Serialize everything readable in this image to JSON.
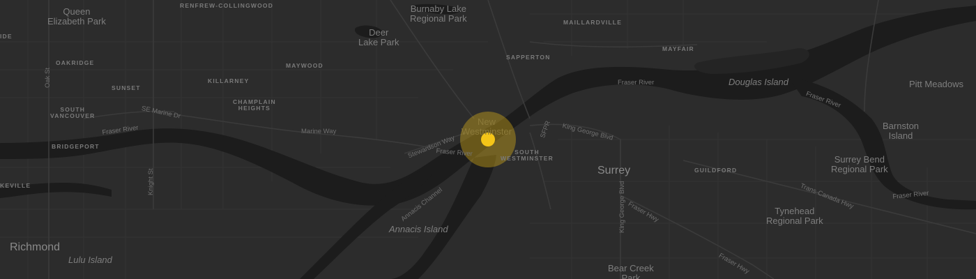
{
  "map": {
    "theme": "dark",
    "colors": {
      "land": "#2c2c2c",
      "water": "#1c1c1c",
      "roads": "#383838",
      "marker": "#f5c518",
      "marker_halo": "rgba(245,197,24,0.35)"
    },
    "marker": {
      "name": "New Westminster"
    },
    "places": {
      "queen_elizabeth_park": "Queen\nElizabeth Park",
      "renfrew": "RENFREW-COLLINGWOOD",
      "burnaby_lake": "Burnaby Lake\nRegional Park",
      "maillardville": "MAILLARDVILLE",
      "deer_lake": "Deer\nLake Park",
      "sapperton": "SAPPERTON",
      "mayfair": "MAYFAIR",
      "ide": "IDE",
      "oakridge": "OAKRIDGE",
      "maywood": "MAYWOOD",
      "killarney": "KILLARNEY",
      "sunset": "SUNSET",
      "champlain": "CHAMPLAIN\nHEIGHTS",
      "south_vancouver": "SOUTH\nVANCOUVER",
      "new_westminster": "New\nWestminster",
      "south_westminster": "SOUTH\nWESTMINSTER",
      "bridgeport": "BRIDGEPORT",
      "surrey": "Surrey",
      "guildford": "GUILDFORD",
      "keville": "KEVILLE",
      "douglas_island": "Douglas Island",
      "pitt_meadows": "Pitt Meadows",
      "barnston_island": "Barnston\nIsland",
      "surrey_bend": "Surrey Bend\nRegional Park",
      "tynehead": "Tynehead\nRegional Park",
      "annacis_island": "Annacis Island",
      "richmond": "Richmond",
      "lulu_island": "Lulu Island",
      "bear_creek": "Bear Creek\nPark"
    },
    "roads": {
      "oak_st": "Oak St",
      "se_marine": "SE Marine Dr",
      "marine_way": "Marine Way",
      "stewardson": "Stewardson Way",
      "knight_st": "Knight St",
      "sfpr": "SFPR",
      "king_george_blvd": "King George Blvd",
      "king_george_blvd_v": "King George Blvd",
      "fraser_hwy_1": "Fraser Hwy",
      "fraser_hwy_2": "Fraser Hwy",
      "trans_canada": "Trans-Canada Hwy",
      "annacis_channel": "Annacis Channel"
    },
    "waters": {
      "fraser_river_1": "Fraser River",
      "fraser_river_2": "Fraser River",
      "fraser_river_3": "Fraser River",
      "fraser_river_4": "Fraser River",
      "fraser_river_5": "Fraser River"
    }
  }
}
